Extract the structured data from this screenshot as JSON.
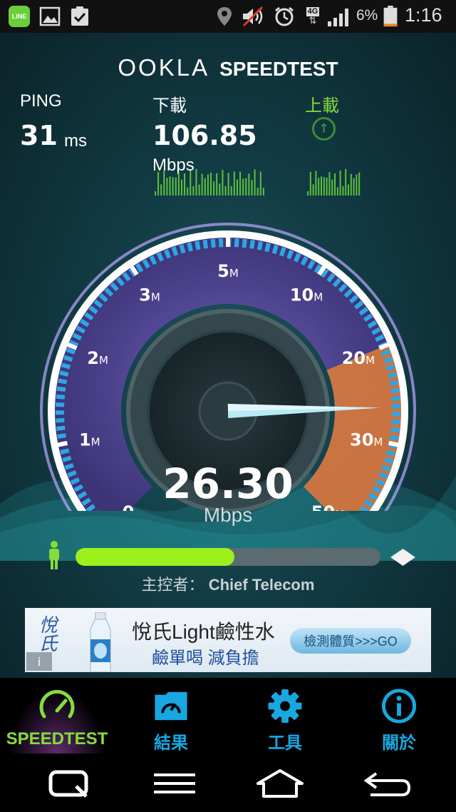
{
  "status_bar": {
    "line_app_label": "LINE",
    "network_label": "4G",
    "battery_text": "6%",
    "time": "1:16"
  },
  "brand": {
    "ookla": "OOKLA",
    "product": "SPEEDTEST"
  },
  "stats": {
    "ping_label": "PING",
    "ping_value": "31",
    "ping_unit": "ms",
    "download_label": "下載",
    "download_value": "106.85",
    "download_unit": "Mbps",
    "upload_label": "上載"
  },
  "gauge": {
    "scale_labels": [
      "0",
      "1",
      "2",
      "3",
      "5",
      "10",
      "20",
      "30",
      "50"
    ],
    "scale_unit": "M",
    "needle_value_mbps": 26.3,
    "current_value": "26.30",
    "current_unit": "Mbps"
  },
  "progress": {
    "fraction": 0.52
  },
  "host": {
    "label": "主控者：",
    "name": "Chief Telecom"
  },
  "ad": {
    "brand": "悅氏",
    "title": "悅氏Light鹼性水",
    "subtitle": "鹼單喝 減負擔",
    "cta": "檢測體質>>>GO",
    "info_icon": "i"
  },
  "tabs": [
    {
      "label": "SPEEDTEST",
      "icon": "speedometer-icon",
      "active": true
    },
    {
      "label": "結果",
      "icon": "folder-gauge-icon",
      "active": false
    },
    {
      "label": "工具",
      "icon": "gear-icon",
      "active": false
    },
    {
      "label": "關於",
      "icon": "info-icon",
      "active": false
    }
  ],
  "colors": {
    "accent_green": "#86dc3a",
    "accent_blue": "#18a7e0",
    "gauge_orange": "#e58a3c",
    "progress_green": "#9cf01e"
  }
}
